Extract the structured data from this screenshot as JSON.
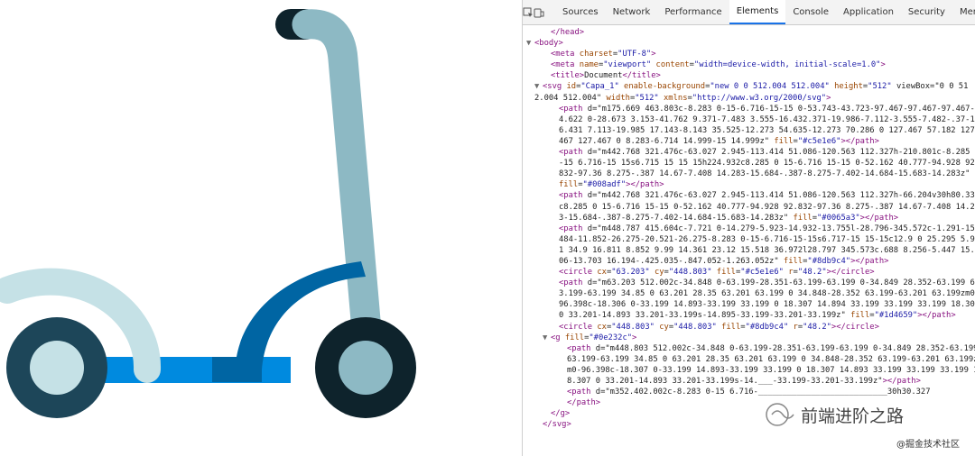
{
  "devtools": {
    "tabs": [
      "Sources",
      "Network",
      "Performance",
      "Elements",
      "Console",
      "Application",
      "Security",
      "Mem"
    ],
    "active_tab": "Elements",
    "lines": [
      {
        "indent": 2,
        "toggle": "",
        "text": "</head>"
      },
      {
        "indent": 0,
        "toggle": "▼",
        "text": "<body>"
      },
      {
        "indent": 2,
        "toggle": "",
        "text": "<meta charset=\"UTF-8\">"
      },
      {
        "indent": 2,
        "toggle": "",
        "text": "<meta name=\"viewport\" content=\"width=device-width, initial-scale=1.0\">"
      },
      {
        "indent": 2,
        "toggle": "",
        "text": "<title>Document</title>"
      },
      {
        "indent": 1,
        "toggle": "▼",
        "text": "<svg id=\"Capa_1\" enable-background=\"new 0 0 512.004 512.004\" height=\"512\" viewBox=\"0 0 51"
      },
      {
        "indent": 0,
        "toggle": "",
        "text": "2.004 512.004\" width=\"512\" xmlns=\"http://www.w3.org/2000/svg\">"
      },
      {
        "indent": 3,
        "toggle": "",
        "text": "<path d=\"m175.669 463.803c-8.283 0-15-6.716-15-15 0-53.743-43.723-97.467-97.467-97.467-1"
      },
      {
        "indent": 3,
        "toggle": "",
        "text": "4.622 0-28.673 3.153-41.762 9.371-7.483 3.555-16.432.371-19.986-7.112-3.555-7.482-.37-1"
      },
      {
        "indent": 3,
        "toggle": "",
        "text": "6.431 7.113-19.985 17.143-8.143 35.525-12.273 54.635-12.273 70.286 0 127.467 57.182 127."
      },
      {
        "indent": 3,
        "toggle": "",
        "text": "467 127.467 0 8.283-6.714 14.999-15 14.999z\" fill=\"#c5e1e6\"></path>"
      },
      {
        "indent": 3,
        "toggle": "",
        "text": "<path d=\"m442.768 321.476c-63.027 2.945-113.414 51.086-120.563 112.327h-210.801c-8.285 0"
      },
      {
        "indent": 3,
        "toggle": "",
        "text": "-15 6.716-15 15s6.715 15 15 15h224.932c8.285 0 15-6.716 15-15 0-52.162 40.777-94.928 92."
      },
      {
        "indent": 3,
        "toggle": "",
        "text": "832-97.36 8.275-.387 14.67-7.408 14.283-15.684-.387-8.275-7.402-14.684-15.683-14.283z\""
      },
      {
        "indent": 3,
        "toggle": "",
        "text": "fill=\"#008adf\"></path>"
      },
      {
        "indent": 3,
        "toggle": "",
        "text": "<path d=\"m442.768 321.476c-63.027 2.945-113.414 51.086-120.563 112.327h-66.204v30h80.335"
      },
      {
        "indent": 3,
        "toggle": "",
        "text": "c8.285 0 15-6.716 15-15 0-52.162 40.777-94.928 92.832-97.36 8.275-.387 14.67-7.408 14.28"
      },
      {
        "indent": 3,
        "toggle": "",
        "text": "3-15.684-.387-8.275-7.402-14.684-15.683-14.283z\" fill=\"#0065a3\"></path>"
      },
      {
        "indent": 3,
        "toggle": "",
        "text": "<path d=\"m448.787 415.604c-7.721 0-14.279-5.923-14.932-13.755l-28.796-345.572c-1.291-15."
      },
      {
        "indent": 3,
        "toggle": "",
        "text": "484-11.852-26.275-20.521-26.275-8.283 0-15-6.716-15-15s6.717-15 15-15c12.9 0 25.295 5.97"
      },
      {
        "indent": 3,
        "toggle": "",
        "text": "1 34.9 16.811 8.852 9.99 14.361 23.12 15.518 36.972l28.797 345.573c.688 8.256-5.447 15.5"
      },
      {
        "indent": 3,
        "toggle": "",
        "text": "06-13.703 16.194-.425.035-.847.052-1.263.052z\" fill=\"#8db9c4\"></path>"
      },
      {
        "indent": 3,
        "toggle": "",
        "text": "<circle cx=\"63.203\" cy=\"448.803\" fill=\"#c5e1e6\" r=\"48.2\"></circle>"
      },
      {
        "indent": 3,
        "toggle": "",
        "text": "<path d=\"m63.203 512.002c-34.848 0-63.199-28.351-63.199-63.199 0-34.849 28.352-63.199 6"
      },
      {
        "indent": 3,
        "toggle": "",
        "text": "3.199-63.199 34.85 0 63.201 28.35 63.201 63.199 0 34.848-28.352 63.199-63.201 63.199zm0-"
      },
      {
        "indent": 3,
        "toggle": "",
        "text": "96.398c-18.306 0-33.199 14.893-33.199 33.199 0 18.307 14.894 33.199 33.199 33.199 18.307"
      },
      {
        "indent": 3,
        "toggle": "",
        "text": "0 33.201-14.893 33.201-33.199s-14.895-33.199-33.201-33.199z\" fill=\"#1d4659\"></path>"
      },
      {
        "indent": 3,
        "toggle": "",
        "text": "<circle cx=\"448.803\" cy=\"448.803\" fill=\"#8db9c4\" r=\"48.2\"></circle>"
      },
      {
        "indent": 2,
        "toggle": "▼",
        "text": "<g fill=\"#0e232c\">"
      },
      {
        "indent": 4,
        "toggle": "",
        "text": "<path d=\"m448.803 512.002c-34.848 0-63.199-28.351-63.199-63.199 0-34.849 28.352-63.199"
      },
      {
        "indent": 4,
        "toggle": "",
        "text": "63.199-63.199 34.85 0 63.201 28.35 63.201 63.199 0 34.848-28.352 63.199-63.201 63.199z"
      },
      {
        "indent": 4,
        "toggle": "",
        "text": "m0-96.398c-18.307 0-33.199 14.893-33.199 33.199 0 18.307 14.893 33.199 33.199 33.199 1"
      },
      {
        "indent": 4,
        "toggle": "",
        "text": "8.307 0 33.201-14.893 33.201-33.199s-14.___-33.199-33.201-33.199z\"></path>"
      },
      {
        "indent": 4,
        "toggle": "",
        "text": "<path d=\"m352.402.002c-8.283 0-15 6.716-___________________________30h30.327"
      },
      {
        "indent": 4,
        "toggle": "",
        "text": "</path>"
      },
      {
        "indent": 2,
        "toggle": "",
        "text": "</g>"
      },
      {
        "indent": 1,
        "toggle": "",
        "text": "</svg>"
      }
    ]
  },
  "watermark": {
    "main": "前端进阶之路",
    "sub": "@掘金技术社区"
  },
  "colors": {
    "deck_blue": "#008adf",
    "dark_blue": "#0065a3",
    "stem": "#8db9c4",
    "fender": "#c5e1e6",
    "wheel_outer_left": "#1d4659",
    "wheel_outer_right": "#0e232c",
    "handle": "#0e232c"
  }
}
